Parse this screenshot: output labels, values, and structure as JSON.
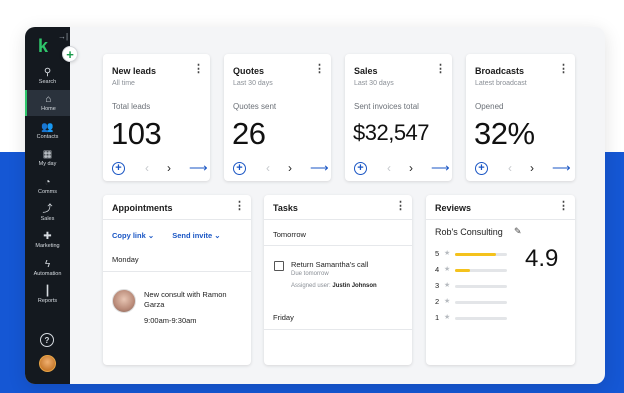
{
  "nav": {
    "items": [
      {
        "label": "Search",
        "icon": "search-icon",
        "glyph": "⚲"
      },
      {
        "label": "Home",
        "icon": "home-icon",
        "glyph": "⌂"
      },
      {
        "label": "Contacts",
        "icon": "contacts-icon",
        "glyph": "👥"
      },
      {
        "label": "My day",
        "icon": "calendar-icon",
        "glyph": "▦"
      },
      {
        "label": "Comms",
        "icon": "chat-icon",
        "glyph": "◔"
      },
      {
        "label": "Sales",
        "icon": "sales-icon",
        "glyph": "⤴"
      },
      {
        "label": "Marketing",
        "icon": "megaphone-icon",
        "glyph": "✚"
      },
      {
        "label": "Automation",
        "icon": "bolt-icon",
        "glyph": "ϟ"
      },
      {
        "label": "Reports",
        "icon": "chart-icon",
        "glyph": "┃"
      }
    ],
    "active": "Home",
    "help_glyph": "?",
    "logo_glyph": "k",
    "collapse_glyph": "→|",
    "fab_glyph": "+"
  },
  "cards": {
    "new_leads": {
      "title": "New leads",
      "subtitle": "All time",
      "metric_label": "Total leads",
      "metric_value": "103"
    },
    "quotes": {
      "title": "Quotes",
      "subtitle": "Last 30 days",
      "metric_label": "Quotes sent",
      "metric_value": "26"
    },
    "sales": {
      "title": "Sales",
      "subtitle": "Last 30 days",
      "metric_label": "Sent invoices total",
      "metric_value": "$32,547"
    },
    "broadcasts": {
      "title": "Broadcasts",
      "subtitle": "Latest broadcast",
      "metric_label": "Opened",
      "metric_value": "32%"
    }
  },
  "action_glyphs": {
    "add": "+",
    "prev": "‹",
    "next": "›",
    "go": "⟶",
    "kebab": "⋮"
  },
  "appointments": {
    "title": "Appointments",
    "copy_link": "Copy link ⌄",
    "send_invite": "Send invite ⌄",
    "day": "Monday",
    "entry": {
      "text": "New consult with Ramon Garza",
      "time": "9:00am-9:30am"
    }
  },
  "tasks": {
    "title": "Tasks",
    "tomorrow": "Tomorrow",
    "task": {
      "title": "Return Samantha's call",
      "due": "Due tomorrow",
      "assigned_label": "Assigned user:",
      "assigned_user": "Justin Johnson"
    },
    "friday": "Friday"
  },
  "reviews": {
    "title": "Reviews",
    "business": "Rob's Consulting",
    "edit_glyph": "✎",
    "rating": "4.9",
    "star_glyph": "★",
    "rows": [
      {
        "stars": "5",
        "fraction": 0.78
      },
      {
        "stars": "4",
        "fraction": 0.28
      },
      {
        "stars": "3",
        "fraction": 0
      },
      {
        "stars": "2",
        "fraction": 0
      },
      {
        "stars": "1",
        "fraction": 0
      }
    ]
  }
}
